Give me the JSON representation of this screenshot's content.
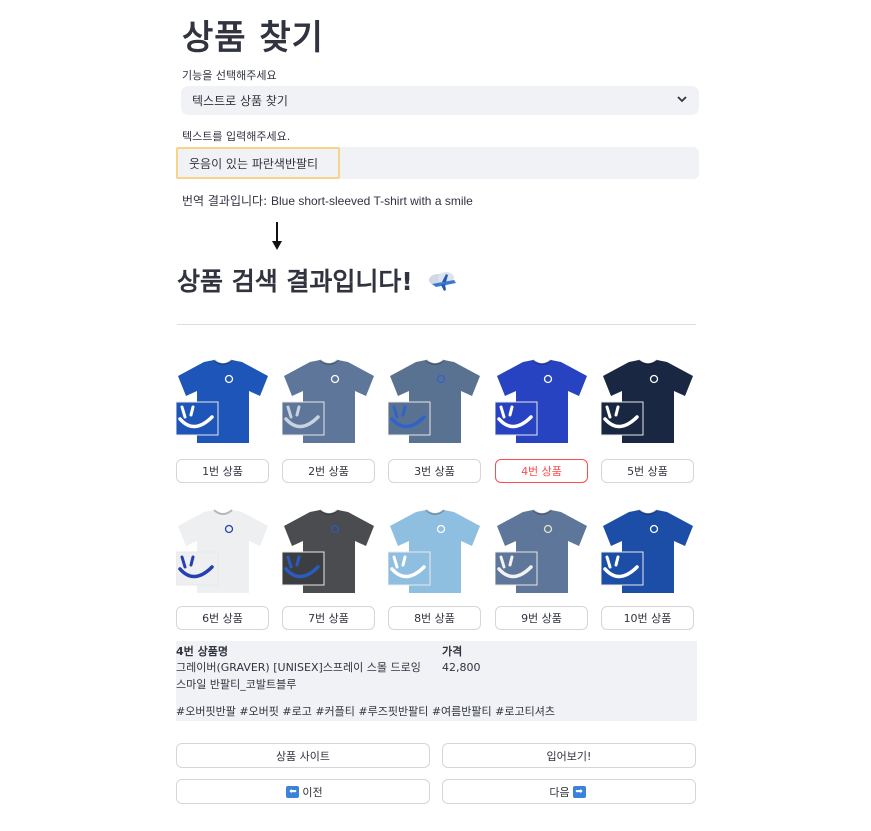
{
  "page": {
    "title": "상품 찾기"
  },
  "function_select": {
    "label": "기능을 선택해주세요",
    "value": "텍스트로 상품 찾기"
  },
  "text_input": {
    "label": "텍스트를 입력해주세요.",
    "value": "웃음이 있는 파란색반팔티"
  },
  "translation": {
    "prefix": "번역 결과입니다:",
    "text": "Blue short-sleeved T-shirt with a smile"
  },
  "results": {
    "title": "상품 검색 결과입니다!",
    "emoji": "cloud-airplane-icon"
  },
  "products": [
    {
      "label": "1번 상품",
      "shirt": "#1d56b8",
      "logo": "#ffffff",
      "inset": "#1d56b8",
      "insetFg": "#ffffff",
      "selected": false
    },
    {
      "label": "2번 상품",
      "shirt": "#5d7699",
      "logo": "#ffffff",
      "inset": "#5d7699",
      "insetFg": "#c8d2e0",
      "selected": false
    },
    {
      "label": "3번 상품",
      "shirt": "#5a7292",
      "logo": "#2f63c9",
      "inset": "#5a7292",
      "insetFg": "#2f63c9",
      "selected": false
    },
    {
      "label": "4번 상품",
      "shirt": "#2743c2",
      "logo": "#ffffff",
      "inset": "#2743c2",
      "insetFg": "#ffffff",
      "selected": true
    },
    {
      "label": "5번 상품",
      "shirt": "#1a2742",
      "logo": "#ffffff",
      "inset": "#1a2742",
      "insetFg": "#ffffff",
      "selected": false
    },
    {
      "label": "6번 상품",
      "shirt": "#eeeff1",
      "logo": "#2540b0",
      "inset": "#eeeff1",
      "insetFg": "#2540b0",
      "selected": false
    },
    {
      "label": "7번 상품",
      "shirt": "#4a4c4f",
      "logo": "#2a5bc0",
      "inset": "#3c3e41",
      "insetFg": "#2a5bc0",
      "selected": false
    },
    {
      "label": "8번 상품",
      "shirt": "#8fbfe0",
      "logo": "#ffffff",
      "inset": "#8fbfe0",
      "insetFg": "#ffffff",
      "selected": false
    },
    {
      "label": "9번 상품",
      "shirt": "#5d7699",
      "logo": "#e8e2c8",
      "inset": "#5d7699",
      "insetFg": "#f2f2f2",
      "selected": false
    },
    {
      "label": "10번 상품",
      "shirt": "#1c4ea8",
      "logo": "#ffffff",
      "inset": "#1c4ea8",
      "insetFg": "#ffffff",
      "selected": false
    }
  ],
  "info": {
    "name_header": "4번 상품명",
    "name_line1": "그레이버(GRAVER) [UNISEX]스프레이 스몰 드로잉",
    "name_line2": "스마일 반팔티_코발트블루",
    "tags": "#오버핏반팔 #오버핏 #로고 #커플티 #루즈핏반팔티 #여름반팔티 #로고티셔츠",
    "price_header": "가격",
    "price": "42,800"
  },
  "actions": {
    "site": "상품 사이트",
    "try_on": "입어보기!",
    "prev": "이전",
    "next": "다음",
    "prev_icon": "left-arrow-icon",
    "next_icon": "right-arrow-icon"
  }
}
